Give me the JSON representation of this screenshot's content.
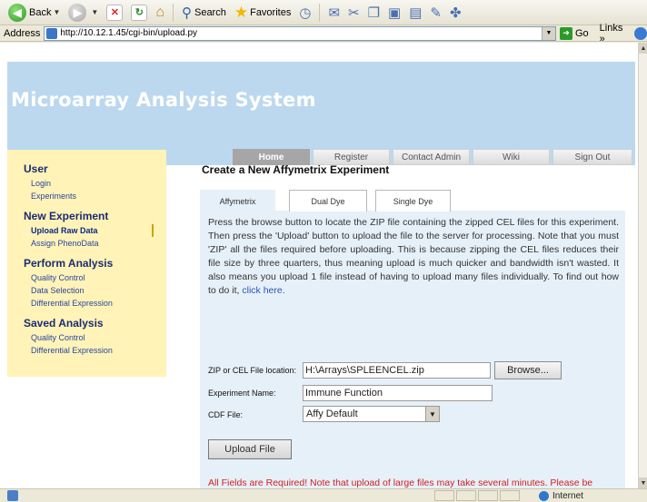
{
  "browser": {
    "toolbar": {
      "back_label": "Back",
      "search_label": "Search",
      "favorites_label": "Favorites"
    },
    "address": {
      "label": "Address",
      "url": "http://10.12.1.45/cgi-bin/upload.py",
      "go_label": "Go",
      "links_label": "Links"
    },
    "status": {
      "zone": "Internet"
    }
  },
  "site": {
    "title": "Microarray Analysis System",
    "nav": [
      {
        "label": "Home",
        "active": true
      },
      {
        "label": "Register"
      },
      {
        "label": "Contact Admin"
      },
      {
        "label": "Wiki"
      },
      {
        "label": "Sign Out"
      }
    ]
  },
  "sidebar": {
    "sections": [
      {
        "heading": "User",
        "links": [
          "Login",
          "Experiments"
        ]
      },
      {
        "heading": "New Experiment",
        "links": [
          "Upload Raw Data",
          "Assign PhenoData"
        ],
        "current": "Upload Raw Data"
      },
      {
        "heading": "Perform Analysis",
        "links": [
          "Quality Control",
          "Data Selection",
          "Differential Expression"
        ]
      },
      {
        "heading": "Saved Analysis",
        "links": [
          "Quality Control",
          "Differential Expression"
        ]
      }
    ]
  },
  "main": {
    "title": "Create a New Affymetrix Experiment",
    "tabs": [
      {
        "label": "Affymetrix",
        "active": true
      },
      {
        "label": "Dual Dye"
      },
      {
        "label": "Single Dye"
      }
    ],
    "description": "Press the browse button to locate the ZIP file containing the zipped CEL files for this experiment. Then press the 'Upload' button to upload the file to the server for processing. Note that you must 'ZIP' all the files required before uploading. This is because zipping the CEL files reduces their file size by three quarters, thus meaning upload is much quicker and bandwidth isn't wasted. It also means you upload 1 file instead of having to upload many files individually. To find out how to do it,",
    "description_link": "click here.",
    "form": {
      "zip_label": "ZIP or CEL File location:",
      "zip_value": "H:\\Arrays\\SPLEENCEL.zip",
      "browse_label": "Browse...",
      "name_label": "Experiment Name:",
      "name_value": "Immune Function",
      "cdf_label": "CDF File:",
      "cdf_value": "Affy Default",
      "upload_label": "Upload File"
    },
    "warning": "All Fields are Required! Note that upload of large files may take several minutes. Please be patient and wait for upload to complete FULLY before proceeding!"
  }
}
